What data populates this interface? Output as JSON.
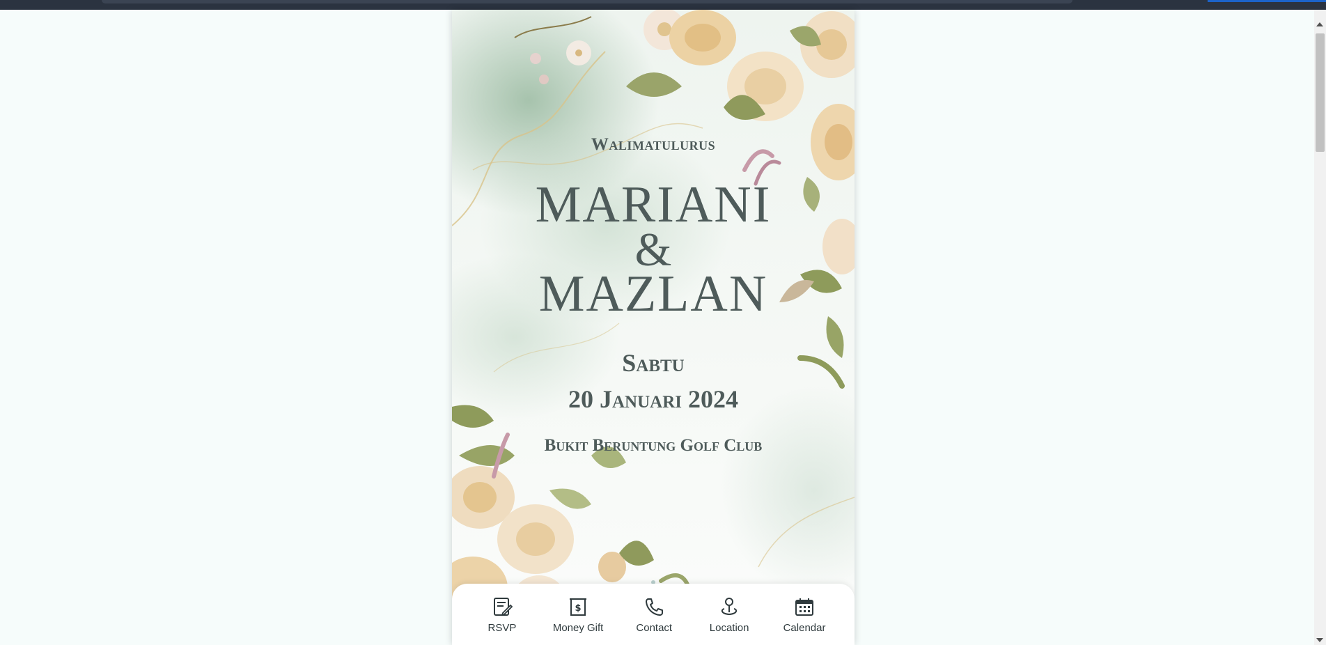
{
  "page": {
    "background_color": "#f6fcfb",
    "text_color": "#4e5b5a"
  },
  "invitation": {
    "eyebrow": "Walimatulurus",
    "bride": "MARIANI",
    "ampersand": "&",
    "groom": "MAZLAN",
    "day": "Sabtu",
    "date": "20 Januari 2024",
    "venue": "Bukit Beruntung Golf Club"
  },
  "carousel": {
    "slide_count": 1,
    "active_index": 0
  },
  "bottom_nav": {
    "items": [
      {
        "label": "RSVP",
        "icon": "rsvp-form-icon"
      },
      {
        "label": "Money Gift",
        "icon": "money-gift-icon"
      },
      {
        "label": "Contact",
        "icon": "phone-icon"
      },
      {
        "label": "Location",
        "icon": "location-pin-icon"
      },
      {
        "label": "Calendar",
        "icon": "calendar-icon"
      }
    ]
  }
}
